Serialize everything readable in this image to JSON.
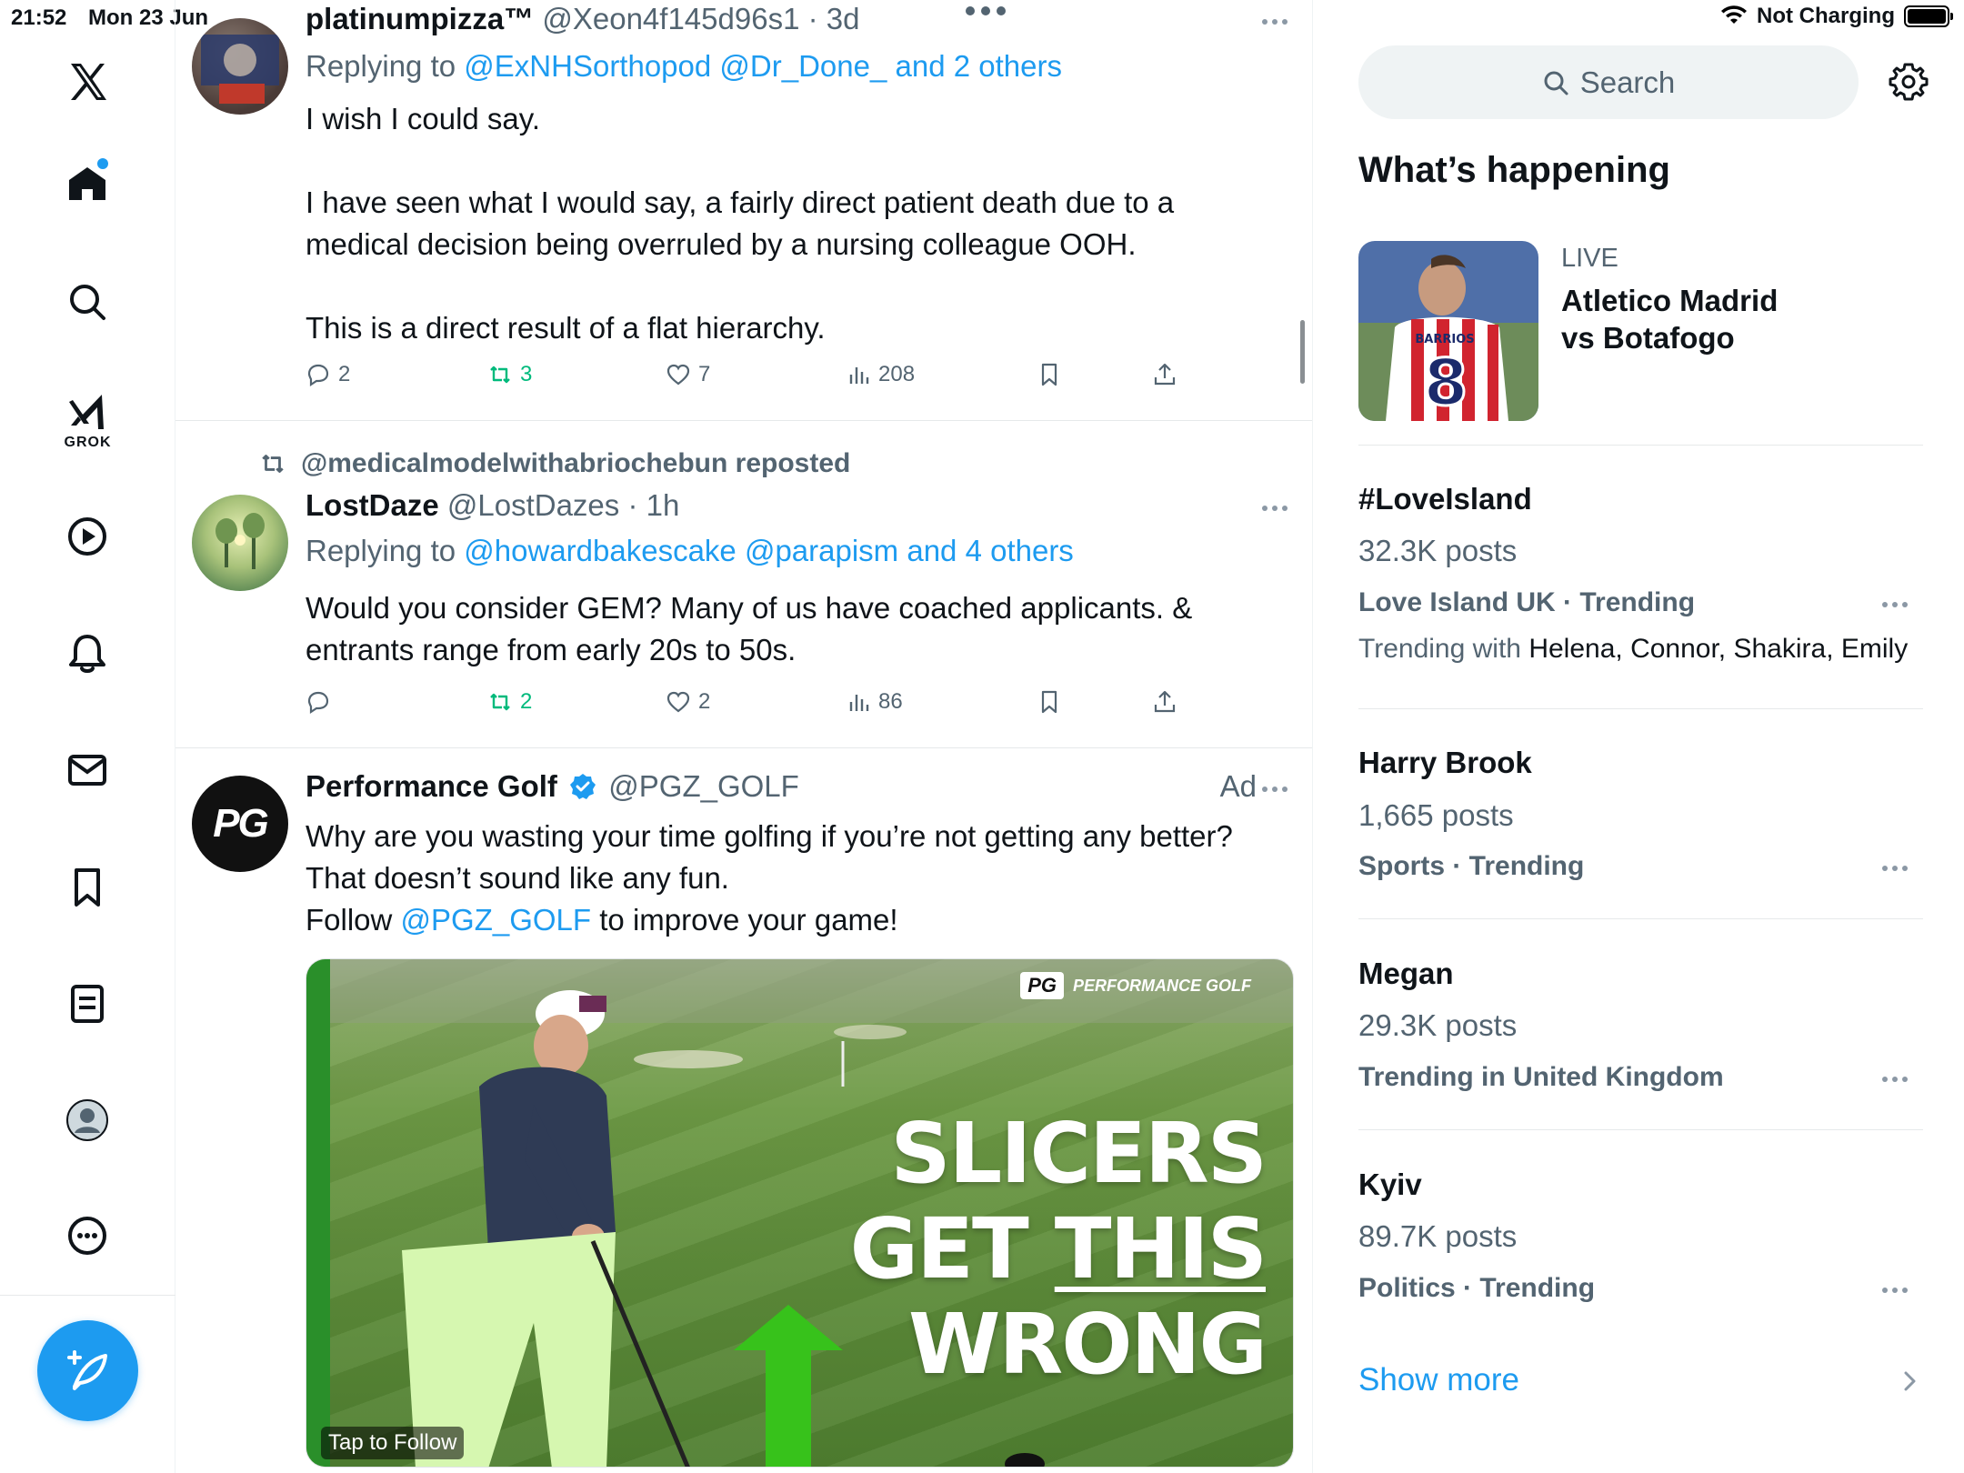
{
  "status_bar": {
    "time": "21:52",
    "date": "Mon 23 Jun",
    "battery_text": "Not Charging"
  },
  "nav": {
    "grok_label": "GROK",
    "items": [
      "x-logo",
      "home-icon",
      "search-icon",
      "grok-icon",
      "video-icon",
      "bell-icon",
      "mail-icon",
      "bookmark-icon",
      "list-icon",
      "profile-icon",
      "more-icon"
    ]
  },
  "feed": {
    "tweet1": {
      "name": "platinumpizza™",
      "handle": "@Xeon4f145d96s1 · 3d",
      "replying_prefix": "Replying to",
      "replying_links": "@ExNHSorthopod @Dr_Done_ and 2 others",
      "body": [
        "I wish I could say.",
        "I have seen what I would say, a fairly direct patient death due to a medical decision being overruled by a nursing colleague OOH.",
        "This is a direct result of a flat hierarchy."
      ],
      "replies": "2",
      "reposts": "3",
      "likes": "7",
      "views": "208"
    },
    "tweet2": {
      "reposted_by": "@medicalmodelwithabriochebun reposted",
      "name": "LostDaze",
      "handle": "@LostDazes · 1h",
      "replying_prefix": "Replying to",
      "replying_links": "@howardbakescake @parapism and 4 others",
      "body": "Would you consider GEM? Many of us have coached applicants. & entrants range from early 20s to 50s.",
      "replies": "",
      "reposts": "2",
      "likes": "2",
      "views": "86"
    },
    "tweet3": {
      "name": "Performance Golf",
      "handle": "@PGZ_GOLF",
      "ad_label": "Ad",
      "avatar_text": "PG",
      "body_line1": "Why are you wasting your time golfing if you’re not getting any better?",
      "body_line2": "That doesn’t sound like any fun.",
      "body_line3_prefix": "Follow",
      "body_line3_link": "@PGZ_GOLF",
      "body_line3_suffix": "to improve your game!",
      "media": {
        "brand_box": "PG",
        "brand_text": "PERFORMANCE GOLF",
        "line1": "SLICERS",
        "line2a": "GET ",
        "line2b": "THIS",
        "line3": "WRONG",
        "tap_follow": "Tap to Follow"
      }
    }
  },
  "sidebar": {
    "search_placeholder": "Search",
    "section_title": "What’s happening",
    "live": {
      "label": "LIVE",
      "title_line1": "Atletico Madrid",
      "title_line2": "vs Botafogo",
      "jersey_name": "BARRIOS",
      "jersey_number": "8"
    },
    "trends": [
      {
        "name": "#LoveIsland",
        "count": "32.3K posts",
        "meta": "Love Island UK · Trending",
        "with_prefix": "Trending with",
        "with_names": "Helena, Connor, Shakira, Emily"
      },
      {
        "name": "Harry Brook",
        "count": "1,665 posts",
        "meta": "Sports · Trending"
      },
      {
        "name": "Megan",
        "count": "29.3K posts",
        "meta": "Trending in United Kingdom"
      },
      {
        "name": "Kyiv",
        "count": "89.7K posts",
        "meta": "Politics · Trending"
      }
    ],
    "show_more": "Show more"
  },
  "colors": {
    "accent": "#1d9bf0",
    "repost_green": "#00ba7c",
    "muted": "#536471",
    "text": "#0f1419"
  }
}
